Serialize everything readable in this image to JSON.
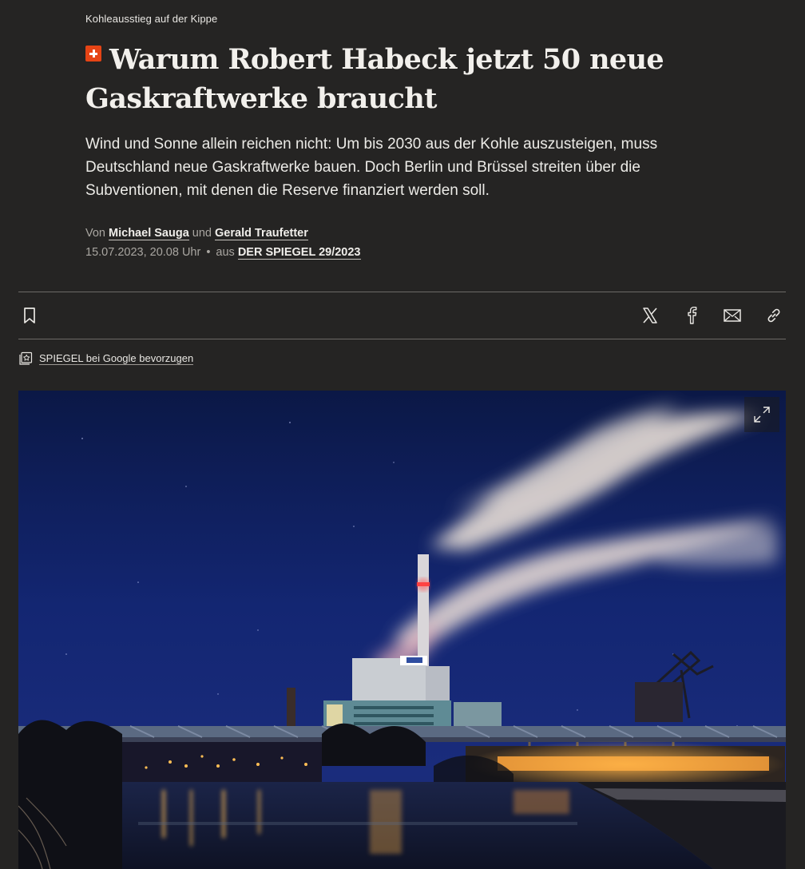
{
  "article": {
    "kicker": "Kohleausstieg auf der Kippe",
    "headline": "Warum Robert Habeck jetzt 50 neue Gaskraftwerke braucht",
    "lead": "Wind und Sonne allein reichen nicht: Um bis 2030 aus der Kohle auszusteigen, muss Deutschland neue Gaskraftwerke bauen. Doch Berlin und Brüssel streiten über die Subventionen, mit denen die Reserve finanziert werden soll.",
    "byline": {
      "prefix": "Von",
      "author1": "Michael Sauga",
      "conjunction": "und",
      "author2": "Gerald Traufetter"
    },
    "meta": {
      "date": "15.07.2023, 20.08 Uhr",
      "separator": "•",
      "source_prefix": "aus",
      "source": "DER SPIEGEL 29/2023"
    }
  },
  "toolbar": {
    "bookmark_icon": "bookmark-icon",
    "share_icons": [
      "x-icon",
      "facebook-icon",
      "mail-icon",
      "link-icon"
    ]
  },
  "google_pref": {
    "label": "SPIEGEL bei Google bevorzugen",
    "icon": "star-image-icon"
  },
  "hero": {
    "expand_icon": "expand-icon"
  },
  "colors": {
    "background": "#252423",
    "accent_badge": "#e64415",
    "sky": "#13256a"
  }
}
